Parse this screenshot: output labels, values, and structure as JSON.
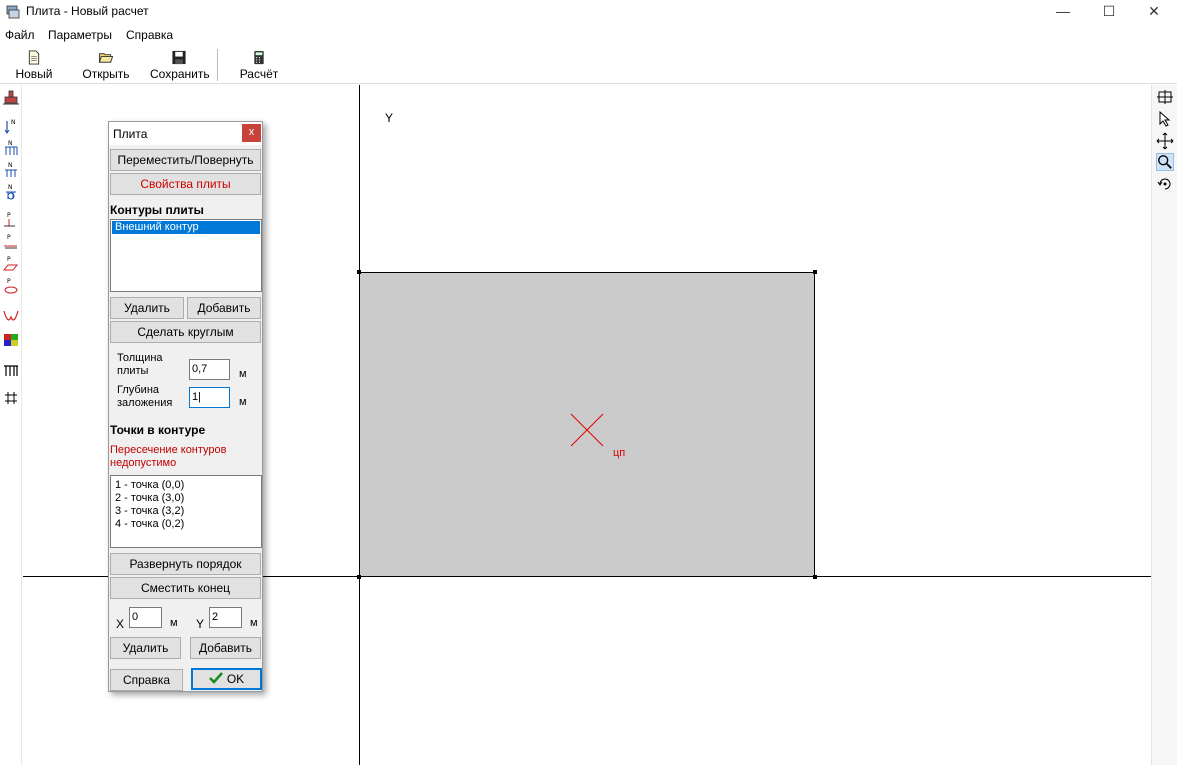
{
  "window": {
    "title": "Плита - Новый расчет",
    "controls": {
      "minimize": "—",
      "maximize": "☐",
      "close": "✕"
    }
  },
  "menu": [
    "Файл",
    "Параметры",
    "Справка"
  ],
  "toolbar": {
    "new": "Новый",
    "open": "Открыть",
    "save": "Сохранить",
    "calc": "Расчёт"
  },
  "canvas": {
    "y_axis_label": "Y",
    "center_label": "цп",
    "plate_color": "#cbcbcb",
    "marker_color": "#e00000"
  },
  "dialog": {
    "title": "Плита",
    "close": "x",
    "move_rotate": "Переместить/Повернуть",
    "plate_props": "Свойства плиты",
    "contours_header": "Контуры плиты",
    "contours": [
      "Внешний контур"
    ],
    "delete": "Удалить",
    "add": "Добавить",
    "make_round": "Сделать круглым",
    "thickness_label_1": "Толщина",
    "thickness_label_2": "плиты",
    "thickness_value": "0,7",
    "depth_label_1": "Глубина",
    "depth_label_2": "заложения",
    "depth_value": "1|",
    "unit_m": "м",
    "points_header": "Точки в контуре",
    "error_line_1": "Пересечение контуров",
    "error_line_2": "недопустимо",
    "points": [
      "1 - точка (0,0)",
      "2 - точка (3,0)",
      "3 - точка (3,2)",
      "4 - точка (0,2)"
    ],
    "reverse_order": "Развернуть порядок",
    "shift_end": "Сместить конец",
    "x_label": "X",
    "x_value": "0",
    "y_label": "Y",
    "y_value": "2",
    "help": "Справка",
    "ok": "OK"
  },
  "colors": {
    "accent": "#0078d7",
    "error": "#c00000",
    "close_btn": "#c9413b"
  }
}
